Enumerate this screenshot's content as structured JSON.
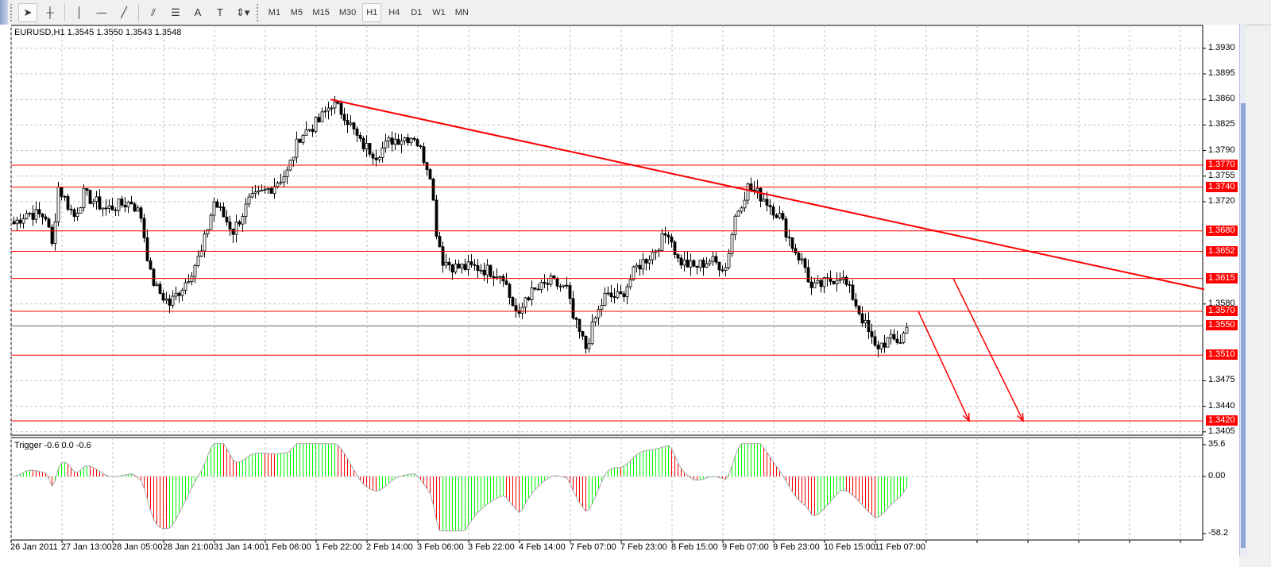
{
  "toolbar": {
    "tools": [
      {
        "name": "cursor-tool",
        "glyph": "➤"
      },
      {
        "name": "crosshair-tool",
        "glyph": "┼"
      },
      {
        "name": "vertical-line-tool",
        "glyph": "│"
      },
      {
        "name": "horizontal-line-tool",
        "glyph": "—"
      },
      {
        "name": "trendline-tool",
        "glyph": "╱"
      },
      {
        "name": "equidistant-channel-tool",
        "glyph": "⫽"
      },
      {
        "name": "fibonacci-tool",
        "glyph": "☰"
      },
      {
        "name": "text-tool",
        "glyph": "A"
      },
      {
        "name": "text-label-tool",
        "glyph": "T"
      },
      {
        "name": "arrows-tool",
        "glyph": "⇕▾"
      }
    ],
    "timeframes": [
      "M1",
      "M5",
      "M15",
      "M30",
      "H1",
      "H4",
      "D1",
      "W1",
      "MN"
    ],
    "selected_timeframe": "H1"
  },
  "chart": {
    "info": "EURUSD,H1  1.3545 1.3550 1.3543 1.3548",
    "price_ticks": [
      "1.3930",
      "1.3895",
      "1.3860",
      "1.3825",
      "1.3790",
      "1.3755",
      "1.3720",
      "1.3580",
      "1.3475",
      "1.3440",
      "1.3405"
    ],
    "level_labels": [
      "1.3770",
      "1.3740",
      "1.3680",
      "1.3652",
      "1.3615",
      "1.3570",
      "1.3550",
      "1.3510",
      "1.3420"
    ],
    "colors": {
      "level": "#ff0000",
      "candle": "#000000",
      "up_bar": "#00ff00",
      "down_bar": "#ff0000",
      "grid": "#c0c0c0"
    }
  },
  "indicator": {
    "legend": "Trigger -0.6 0.0 -0.6",
    "ticks": [
      "35.6",
      "0.00",
      "-58.2"
    ]
  },
  "time_axis": [
    "26 Jan 2011",
    "27 Jan 13:00",
    "28 Jan 05:00",
    "28 Jan 21:00",
    "31 Jan 14:00",
    "1 Feb 06:00",
    "1 Feb 22:00",
    "2 Feb 14:00",
    "3 Feb 06:00",
    "3 Feb 22:00",
    "4 Feb 14:00",
    "7 Feb 07:00",
    "7 Feb 23:00",
    "8 Feb 15:00",
    "9 Feb 07:00",
    "9 Feb 23:00",
    "10 Feb 15:00",
    "11 Feb 07:00"
  ],
  "chart_data": {
    "type": "candlestick",
    "symbol": "EURUSD",
    "timeframe": "H1",
    "ylim": [
      1.3395,
      1.395
    ],
    "close_waypoints": [
      [
        0,
        1.369
      ],
      [
        4,
        1.3705
      ],
      [
        10,
        1.37
      ],
      [
        12,
        1.366
      ],
      [
        14,
        1.374
      ],
      [
        19,
        1.37
      ],
      [
        22,
        1.373
      ],
      [
        29,
        1.371
      ],
      [
        37,
        1.372
      ],
      [
        40,
        1.37
      ],
      [
        43,
        1.362
      ],
      [
        45,
        1.36
      ],
      [
        49,
        1.358
      ],
      [
        54,
        1.361
      ],
      [
        59,
        1.365
      ],
      [
        63,
        1.372
      ],
      [
        66,
        1.37
      ],
      [
        69,
        1.368
      ],
      [
        74,
        1.372
      ],
      [
        81,
        1.374
      ],
      [
        86,
        1.376
      ],
      [
        90,
        1.381
      ],
      [
        96,
        1.383
      ],
      [
        100,
        1.3855
      ],
      [
        104,
        1.384
      ],
      [
        109,
        1.38
      ],
      [
        114,
        1.3785
      ],
      [
        119,
        1.3805
      ],
      [
        126,
        1.381
      ],
      [
        131,
        1.376
      ],
      [
        133,
        1.368
      ],
      [
        135,
        1.364
      ],
      [
        139,
        1.363
      ],
      [
        146,
        1.363
      ],
      [
        154,
        1.362
      ],
      [
        156,
        1.359
      ],
      [
        159,
        1.356
      ],
      [
        161,
        1.359
      ],
      [
        169,
        1.361
      ],
      [
        174,
        1.36
      ],
      [
        176,
        1.356
      ],
      [
        180,
        1.352
      ],
      [
        183,
        1.356
      ],
      [
        186,
        1.359
      ],
      [
        191,
        1.359
      ],
      [
        196,
        1.363
      ],
      [
        201,
        1.365
      ],
      [
        206,
        1.368
      ],
      [
        209,
        1.364
      ],
      [
        214,
        1.363
      ],
      [
        219,
        1.364
      ],
      [
        224,
        1.363
      ],
      [
        227,
        1.37
      ],
      [
        231,
        1.374
      ],
      [
        236,
        1.3725
      ],
      [
        241,
        1.37
      ],
      [
        245,
        1.366
      ],
      [
        249,
        1.363
      ],
      [
        251,
        1.36
      ],
      [
        256,
        1.361
      ],
      [
        260,
        1.362
      ],
      [
        264,
        1.359
      ],
      [
        267,
        1.356
      ],
      [
        271,
        1.352
      ],
      [
        275,
        1.353
      ],
      [
        279,
        1.353
      ],
      [
        281,
        1.3548
      ]
    ],
    "horizontal_levels": [
      1.377,
      1.374,
      1.368,
      1.3652,
      1.3615,
      1.357,
      1.355,
      1.351,
      1.342
    ],
    "trendline": [
      [
        100,
        1.386
      ],
      [
        375,
        1.36
      ]
    ],
    "projection_arrows": [
      [
        [
          285,
          1.357
        ],
        [
          301,
          1.342
        ]
      ],
      [
        [
          296,
          1.3615
        ],
        [
          318,
          1.342
        ]
      ]
    ],
    "indicator": {
      "name": "Trigger",
      "ylim": [
        -58.2,
        35.6
      ],
      "zero": 0
    }
  }
}
